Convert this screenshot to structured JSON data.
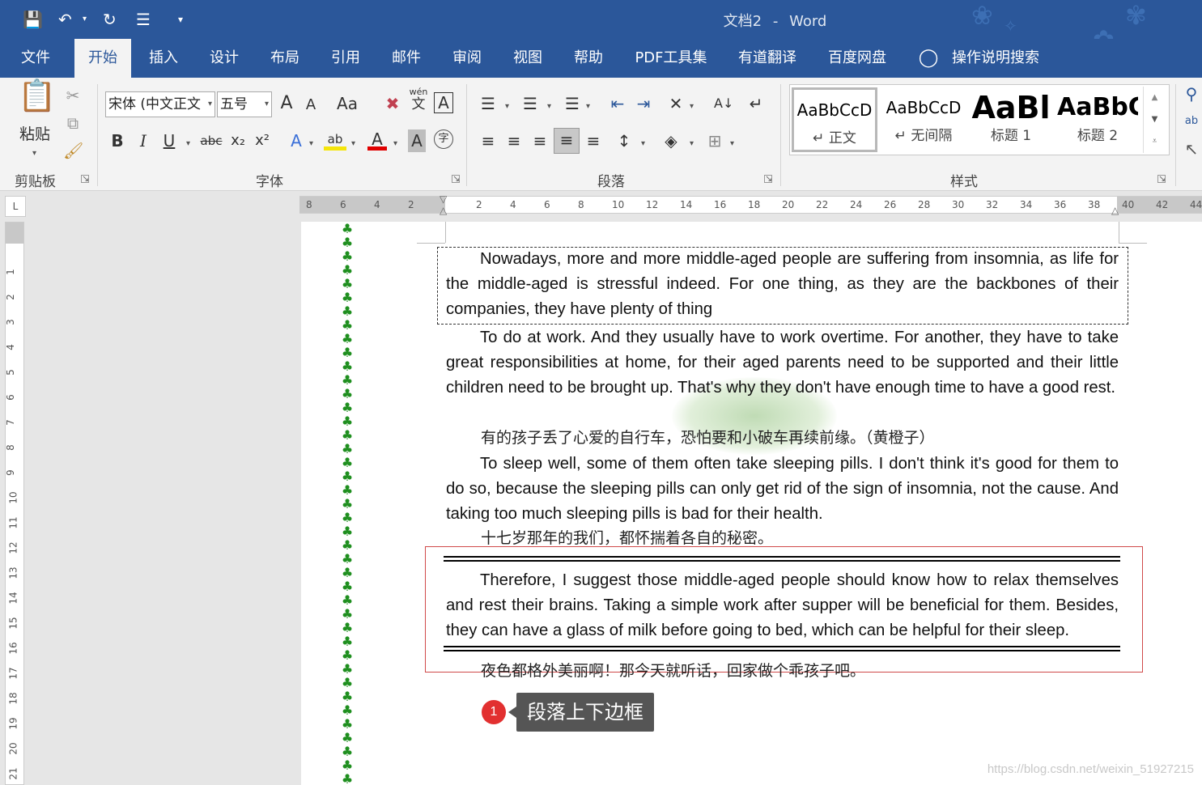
{
  "title": {
    "doc": "文档2",
    "sep": "-",
    "app": "Word"
  },
  "quick_access": {
    "customize": "▾"
  },
  "tabs": [
    "文件",
    "开始",
    "插入",
    "设计",
    "布局",
    "引用",
    "邮件",
    "审阅",
    "视图",
    "帮助",
    "PDF工具集",
    "有道翻译",
    "百度网盘",
    "操作说明搜索"
  ],
  "ribbon": {
    "clipboard": {
      "paste": "粘贴",
      "label": "剪贴板"
    },
    "font": {
      "name": "宋体 (中文正文",
      "size": "五号",
      "grow": "A",
      "shrink": "A",
      "case": "Aa",
      "phonetic": "wén",
      "phonetic_char": "文",
      "border_char": "A",
      "bold": "B",
      "italic": "I",
      "underline": "U",
      "strike": "abc",
      "sub": "x₂",
      "sup": "x²",
      "effects": "A",
      "highlight": "ab",
      "color": "A",
      "shade": "A",
      "enclose": "字",
      "label": "字体"
    },
    "paragraph": {
      "label": "段落"
    },
    "styles": {
      "label": "样式",
      "items": [
        {
          "sample": "AaBbCcD",
          "name": "↵ 正文"
        },
        {
          "sample": "AaBbCcD",
          "name": "↵ 无间隔"
        },
        {
          "sample": "AaBl",
          "name": "标题 1"
        },
        {
          "sample": "AaBbC",
          "name": "标题 2"
        }
      ]
    }
  },
  "ruler": {
    "left_labels": [
      "8",
      "6",
      "4",
      "2"
    ],
    "right_labels": [
      "2",
      "4",
      "6",
      "8",
      "10",
      "12",
      "14",
      "16",
      "18",
      "20",
      "22",
      "24",
      "26",
      "28",
      "30",
      "32",
      "34",
      "36",
      "38",
      "40",
      "42",
      "44"
    ],
    "vertical_labels": [
      "1",
      "2",
      "3",
      "4",
      "5",
      "6",
      "7",
      "8",
      "9",
      "10",
      "11",
      "12",
      "13",
      "14",
      "15",
      "16",
      "17",
      "18",
      "19",
      "20",
      "21"
    ]
  },
  "document": {
    "p1": "Nowadays, more and more middle-aged people are suffering from insomnia, as life for the middle-aged is stressful indeed. For one thing, as they are the backbones of their companies, they have plenty of thing",
    "p2": "To do at work. And they usually have to work overtime. For another, they have to take great responsibilities at home, for their aged parents need to be supported and their little children need to be brought up. That's why they don't have enough time to have a good rest.",
    "cn1": "有的孩子丢了心爱的自行车，恐怕要和小破车再续前缘。（黄橙子）",
    "p3": "To sleep well, some of them often take sleeping pills. I don't think it's good for them to do so, because the sleeping pills can only get rid of the sign of insomnia, not the cause. And taking too much sleeping pills is bad for their health.",
    "cn2": "十七岁那年的我们，都怀揣着各自的秘密。",
    "p4": "Therefore, I suggest those middle-aged people should know how to relax themselves and rest their brains. Taking a simple work after supper will be beneficial for them. Besides, they can have a glass of milk before going to bed, which can be helpful for their sleep.",
    "cn3": "夜色都格外美丽啊！那今天就听话，回家做个乖孩子吧。"
  },
  "callout": {
    "number": "1",
    "text": "段落上下边框"
  },
  "watermark": "https://blog.csdn.net/weixin_51927215",
  "colors": {
    "brand": "#2b579a",
    "callout_red": "#e23030",
    "border_red": "#d04a4a",
    "tree_green": "#1f8f1f"
  }
}
